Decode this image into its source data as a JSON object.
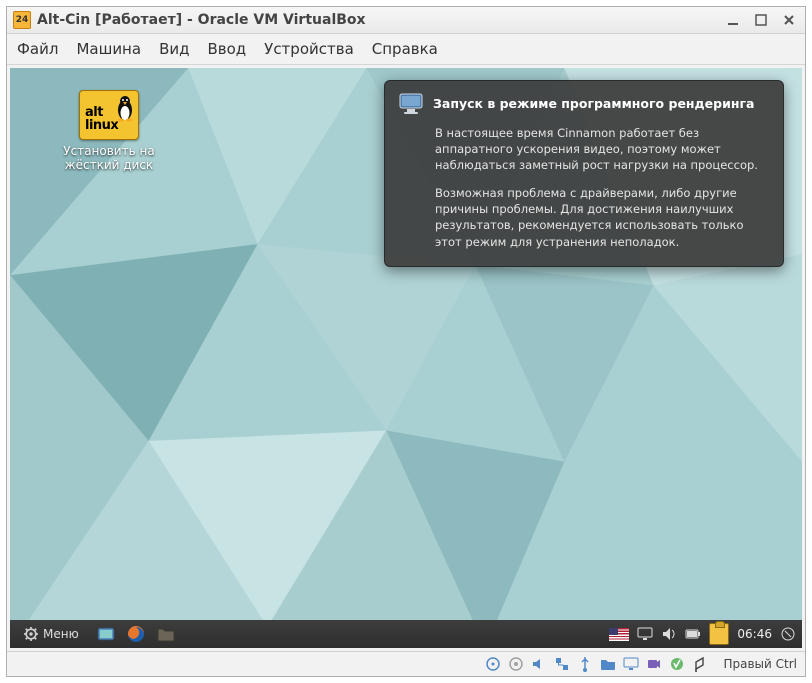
{
  "window": {
    "title": "Alt-Cin [Работает] - Oracle VM VirtualBox",
    "icon_badge": "24"
  },
  "menubar": {
    "file": "Файл",
    "machine": "Машина",
    "view": "Вид",
    "input": "Ввод",
    "devices": "Устройства",
    "help": "Справка"
  },
  "desktop_icon": {
    "logo_top": "alt",
    "logo_bottom": "linux",
    "label": "Установить на жёсткий диск"
  },
  "notification": {
    "title": "Запуск в режиме программного рендеринга",
    "p1": "В настоящее время Cinnamon работает без аппаратного ускорения видео, поэтому может наблюдаться заметный рост нагрузки на процессор.",
    "p2": "Возможная проблема с драйверами, либо другие причины проблемы. Для достижения наилучших результатов, рекомендуется использовать только этот режим для устранения неполадок."
  },
  "taskbar": {
    "menu_label": "Меню",
    "clock": "06:46"
  },
  "statusbar": {
    "host_key": "Правый Ctrl"
  }
}
